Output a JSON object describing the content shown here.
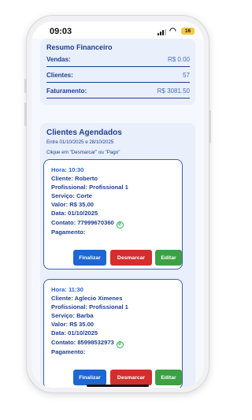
{
  "status": {
    "time": "09:03",
    "battery": "16"
  },
  "resumo": {
    "title": "Resumo Financeiro",
    "rows": [
      {
        "label": "Vendas:",
        "value": "R$ 0.00"
      },
      {
        "label": "Clientes:",
        "value": "57"
      },
      {
        "label": "Faturamento:",
        "value": "R$ 3081.50"
      }
    ]
  },
  "agendados": {
    "title": "Clientes Agendados",
    "range": "Entre 01/10/2025 e 28/10/2025",
    "hint": "Clique em \"Desmarcar\" ou \"Pago\"",
    "appointments": [
      {
        "hora": "Hora: 10:30",
        "cliente": "Cliente: Roberto",
        "profissional": "Profissional: Profissional 1",
        "servico": "Serviço: Corte",
        "valor": "Valor: R$ 35.00",
        "data": "Data: 01/10/2025",
        "contato": "Contato: 77999670360",
        "pagamento": "Pagamento:"
      },
      {
        "hora": "Hora: 11:30",
        "cliente": "Cliente: Aglecio Ximenes",
        "profissional": "Profissional: Profissional 1",
        "servico": "Serviço: Barba",
        "valor": "Valor: R$ 35.00",
        "data": "Data: 01/10/2025",
        "contato": "Contato: 85998532973",
        "pagamento": "Pagamento:"
      }
    ],
    "buttons": {
      "finalizar": "Finalizar",
      "desmarcar": "Desmarcar",
      "editar": "Editar"
    }
  },
  "colors": {
    "primary": "#1d3f91",
    "finalizar": "#1e66d1",
    "desmarcar": "#d42d2d",
    "editar": "#3ea045",
    "whatsapp": "#25b04a"
  },
  "icons": {
    "whatsapp": "whatsapp-icon",
    "wifi": "wifi-icon",
    "signal": "signal-icon",
    "battery": "battery-icon"
  }
}
